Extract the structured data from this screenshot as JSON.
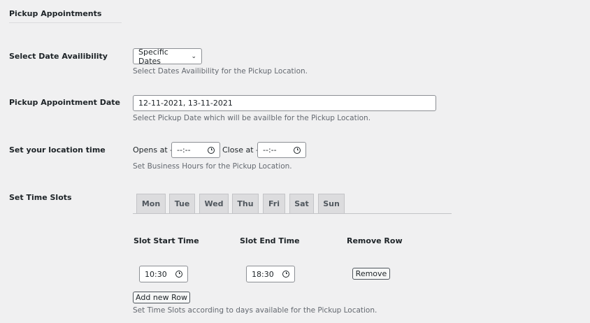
{
  "section_title": "Pickup Appointments",
  "date_availability": {
    "label": "Select Date Availibility",
    "value": "Specific Dates",
    "help": "Select Dates Availibility for the Pickup Location."
  },
  "appointment_date": {
    "label": "Pickup Appointment Date",
    "value": "12-11-2021, 13-11-2021",
    "help": "Select Pickup Date which will be availble for the Pickup Location."
  },
  "location_time": {
    "label": "Set your location time",
    "opens_label": "Opens at -",
    "opens_value": "--:--",
    "close_label": "Close at -",
    "close_value": "--:--",
    "help": "Set Business Hours for the Pickup Location."
  },
  "time_slots": {
    "label": "Set Time Slots",
    "tabs": [
      "Mon",
      "Tue",
      "Wed",
      "Thu",
      "Fri",
      "Sat",
      "Sun"
    ],
    "col_start": "Slot Start Time",
    "col_end": "Slot End Time",
    "col_remove": "Remove Row",
    "rows": [
      {
        "start": "10:30",
        "end": "18:30",
        "remove": "Remove"
      }
    ],
    "add_row": "Add new Row",
    "help": "Set Time Slots according to days available for the Pickup Location."
  }
}
